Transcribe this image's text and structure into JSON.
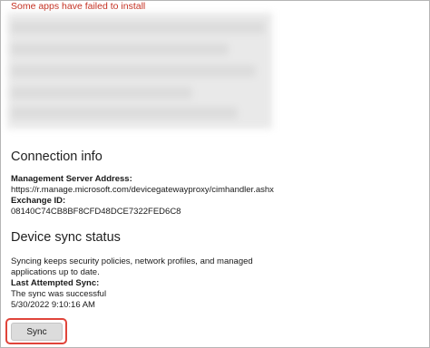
{
  "error_banner": "Some apps have failed to install",
  "connection_info": {
    "title": "Connection info",
    "management_server_label": "Management Server Address:",
    "management_server_value": "https://r.manage.microsoft.com/devicegatewayproxy/cimhandler.ashx",
    "exchange_id_label": "Exchange ID:",
    "exchange_id_value": "08140C74CB8BF8CFD48DCE7322FED6C8"
  },
  "device_sync": {
    "title": "Device sync status",
    "description_line1": "Syncing keeps security policies, network profiles, and managed",
    "description_line2": "applications up to date.",
    "last_attempted_label": "Last Attempted Sync:",
    "status_value": "The sync was successful",
    "timestamp_value": "5/30/2022 9:10:16 AM",
    "sync_button_label": "Sync"
  },
  "colors": {
    "error_red": "#c42b1c",
    "highlight_red": "#e0443a",
    "button_gray": "#dcdcdc"
  }
}
